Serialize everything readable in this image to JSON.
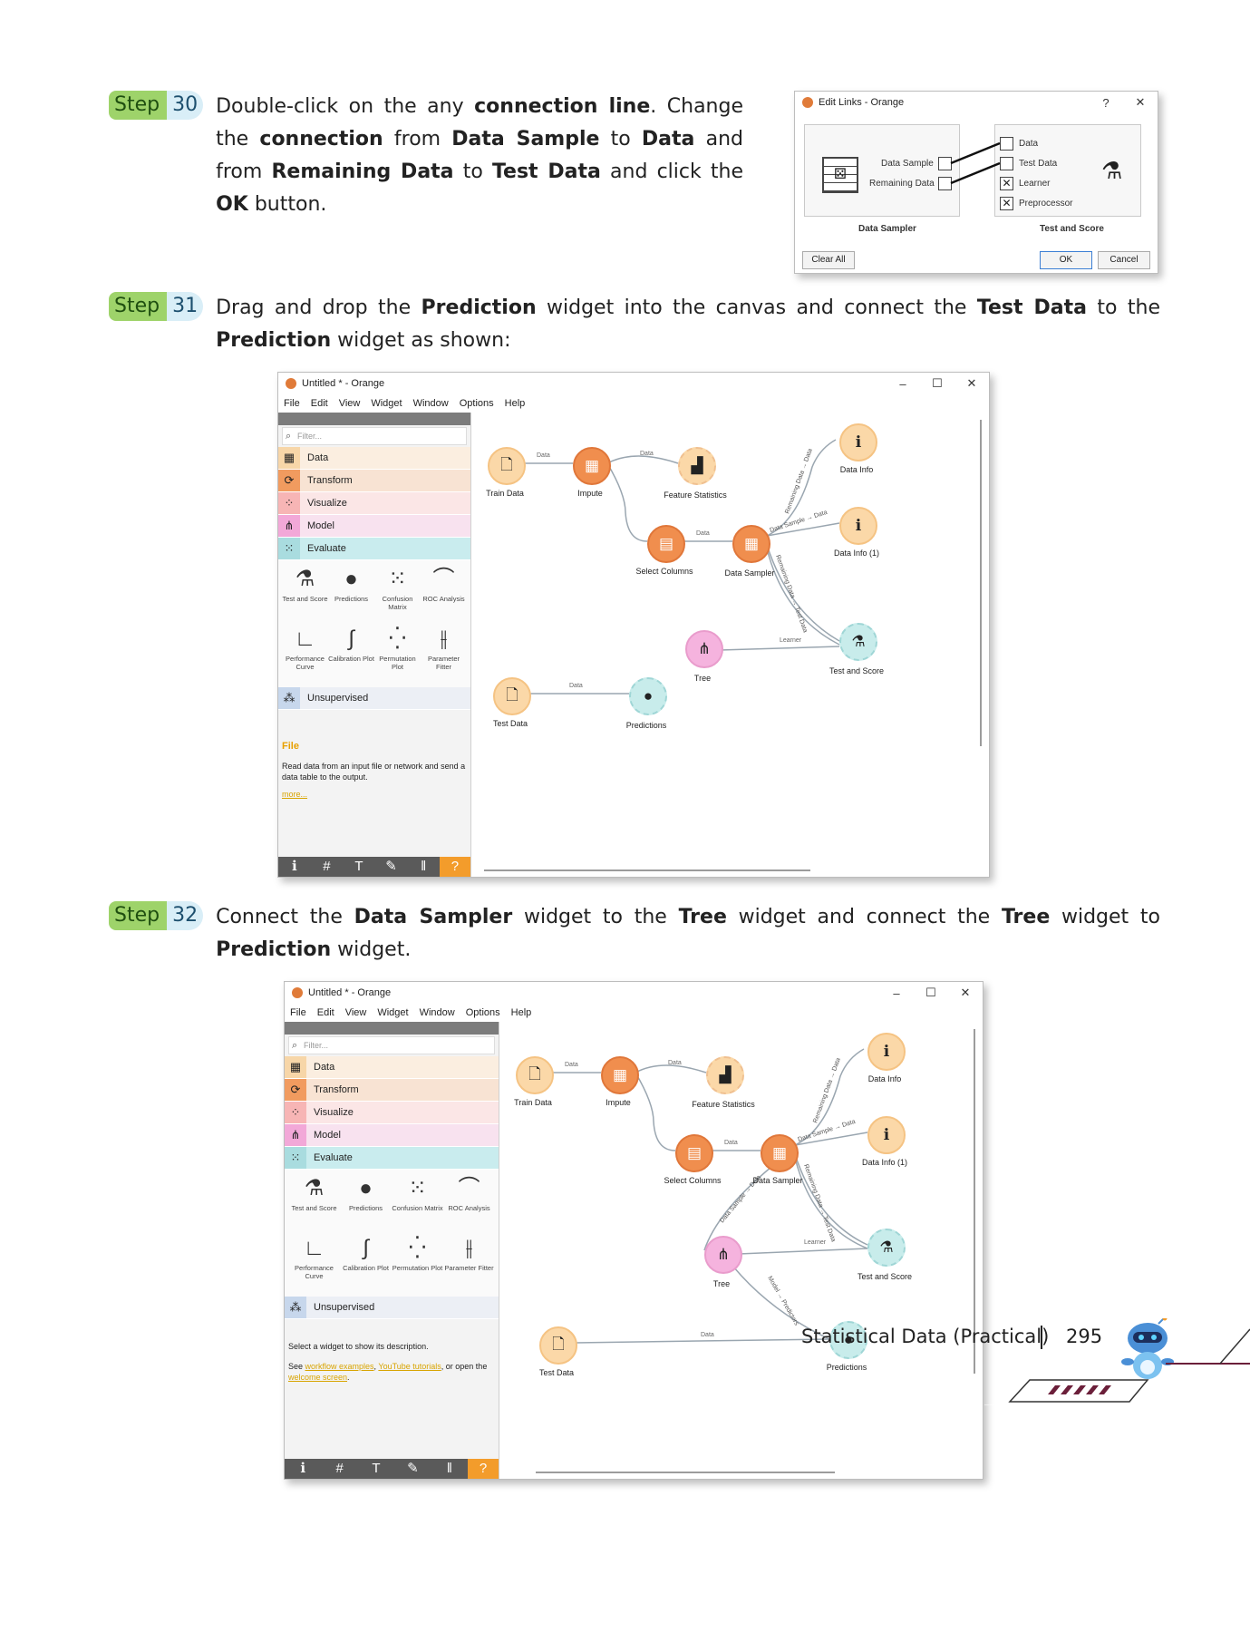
{
  "steps": [
    {
      "word": "Step",
      "num": "30"
    },
    {
      "word": "Step",
      "num": "31"
    },
    {
      "word": "Step",
      "num": "32"
    }
  ],
  "step30": {
    "t1": "Double-click on the any ",
    "b1": "connection line",
    "t2": ". Change the ",
    "b2": "connection",
    "t3": " from ",
    "b3": "Data Sample",
    "t4": " to ",
    "b4": "Data",
    "t5": " and from ",
    "b5": "Remaining Data",
    "t6": " to ",
    "b6": "Test Data",
    "t7": " and click the ",
    "b7": "OK",
    "t8": " button."
  },
  "step31": {
    "t1": "Drag and drop the ",
    "b1": "Prediction",
    "t2": " widget into the canvas and connect the ",
    "b2": "Test Data",
    "t3": " to the ",
    "b3": "Prediction",
    "t4": " widget as shown:"
  },
  "step32": {
    "t1": "Connect the ",
    "b1": "Data Sampler",
    "t2": " widget to the ",
    "b2": "Tree",
    "t3": " widget and connect the ",
    "b3": "Tree",
    "t4": " widget to ",
    "b4": "Prediction",
    "t5": " widget."
  },
  "dialog": {
    "title": "Edit Links - Orange",
    "help": "?",
    "close": "✕",
    "left_outputs": [
      "Data Sample",
      "Remaining Data"
    ],
    "right_inputs": [
      "Data",
      "Test Data",
      "Learner",
      "Preprocessor"
    ],
    "left_name": "Data Sampler",
    "right_name": "Test and Score",
    "clear_all": "Clear All",
    "ok": "OK",
    "cancel": "Cancel"
  },
  "orange": {
    "title": "Untitled * - Orange",
    "menus": [
      "File",
      "Edit",
      "View",
      "Widget",
      "Window",
      "Options",
      "Help"
    ],
    "filter": "Filter...",
    "categories": [
      "Data",
      "Transform",
      "Visualize",
      "Model",
      "Evaluate",
      "Unsupervised"
    ],
    "tools": [
      "Test and Score",
      "Predictions",
      "Confusion Matrix",
      "ROC Analysis",
      "Performance Curve",
      "Calibration Plot",
      "Permutation Plot",
      "Parameter Fitter"
    ],
    "nodes": {
      "train": "Train Data",
      "impute": "Impute",
      "feat": "Feature Statistics",
      "select": "Select Columns",
      "sampler": "Data Sampler",
      "info": "Data Info",
      "info1": "Data Info (1)",
      "tree": "Tree",
      "tas": "Test and Score",
      "test": "Test Data",
      "pred": "Predictions"
    },
    "edges": {
      "data": "Data",
      "learner": "Learner",
      "rem": "Remaining Data → Data",
      "ds": "Data Sample → Data",
      "dts": "Data Sample → Test Data",
      "model": "Model → Predictors"
    }
  },
  "desc1": {
    "title": "File",
    "text": "Read data from an input file or network and send a data table to the output.",
    "more": "more..."
  },
  "desc2": {
    "t1": "Select a widget to show its description.",
    "t2": "See ",
    "l1": "workflow examples",
    "t3": ", ",
    "l2": "YouTube tutorials",
    "t4": ", or open the ",
    "l3": "welcome screen",
    "t5": "."
  },
  "footer": {
    "title": "Statistical Data (Practical)",
    "page": "295"
  }
}
